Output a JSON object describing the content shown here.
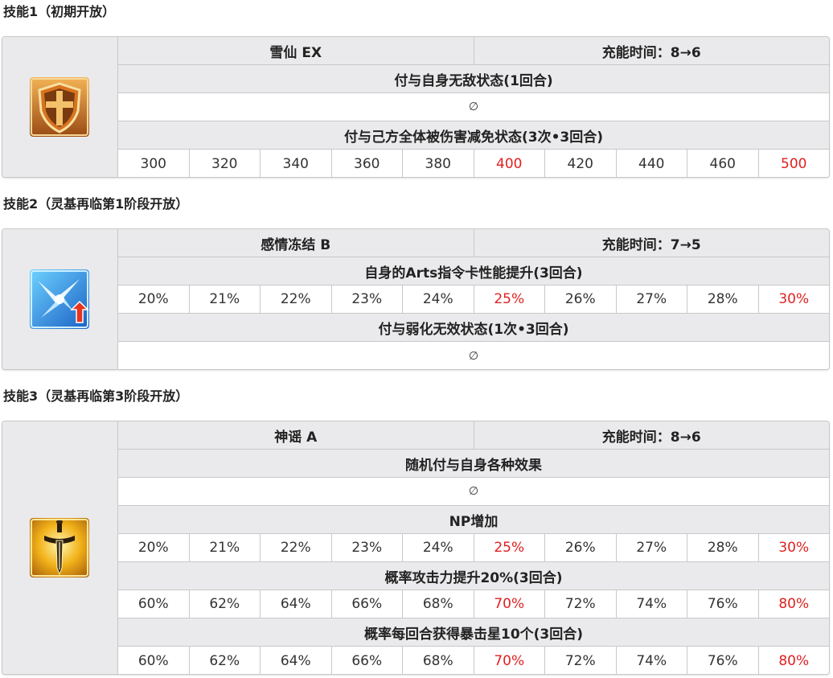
{
  "skills": [
    {
      "heading": "技能1（初期开放）",
      "name": "雪仙 EX",
      "cooldown": "充能时间：8→6",
      "icon": "shield-icon",
      "effects": [
        {
          "title": "付与自身无敌状态(1回合)",
          "values": null,
          "null_text": "∅"
        },
        {
          "title": "付与己方全体被伤害减免状态(3次•3回合)",
          "values": [
            "300",
            "320",
            "340",
            "360",
            "380",
            "400",
            "420",
            "440",
            "460",
            "500"
          ]
        }
      ]
    },
    {
      "heading": "技能2（灵基再临第1阶段开放）",
      "name": "感情冻结 B",
      "cooldown": "充能时间：7→5",
      "icon": "arts-up-icon",
      "effects": [
        {
          "title": "自身的Arts指令卡性能提升(3回合)",
          "values": [
            "20%",
            "21%",
            "22%",
            "23%",
            "24%",
            "25%",
            "26%",
            "27%",
            "28%",
            "30%"
          ]
        },
        {
          "title": "付与弱化无效状态(1次•3回合)",
          "values": null,
          "null_text": "∅"
        }
      ]
    },
    {
      "heading": "技能3（灵基再临第3阶段开放）",
      "name": "神谣 A",
      "cooldown": "充能时间：8→6",
      "icon": "sword-icon",
      "effects": [
        {
          "title": "随机付与自身各种效果",
          "values": null,
          "null_text": "∅"
        },
        {
          "title": "NP增加",
          "values": [
            "20%",
            "21%",
            "22%",
            "23%",
            "24%",
            "25%",
            "26%",
            "27%",
            "28%",
            "30%"
          ]
        },
        {
          "title": "概率攻击力提升20%(3回合)",
          "values": [
            "60%",
            "62%",
            "64%",
            "66%",
            "68%",
            "70%",
            "72%",
            "74%",
            "76%",
            "80%"
          ]
        },
        {
          "title": "概率每回合获得暴击星10个(3回合)",
          "values": [
            "60%",
            "62%",
            "64%",
            "66%",
            "68%",
            "70%",
            "72%",
            "74%",
            "76%",
            "80%"
          ]
        }
      ]
    }
  ],
  "highlight_color": "#e02020"
}
